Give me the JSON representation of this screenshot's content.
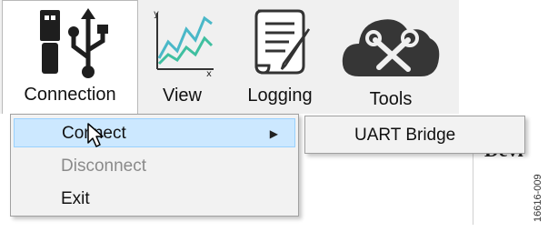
{
  "ribbon": {
    "buttons": [
      {
        "label": "Connection",
        "icon": "usb-icon",
        "active": true
      },
      {
        "label": "View",
        "icon": "line-chart-icon",
        "active": false
      },
      {
        "label": "Logging",
        "icon": "scroll-quill-icon",
        "active": false
      },
      {
        "label": "Tools",
        "icon": "cloud-tools-icon",
        "active": false
      }
    ]
  },
  "connection_menu": {
    "items": [
      {
        "label": "Connect",
        "state": "highlighted",
        "has_submenu": true,
        "arrow": "▶"
      },
      {
        "label": "Disconnect",
        "state": "disabled"
      },
      {
        "label": "Exit",
        "state": "enabled"
      }
    ]
  },
  "connect_submenu": {
    "items": [
      {
        "label": "UART Bridge"
      }
    ]
  },
  "background": {
    "heading_fragment": "Devi"
  },
  "figure_id": "16616-009",
  "colors": {
    "ribbon_bg": "#f0f0f0",
    "menu_bg": "#f2f2f2",
    "highlight_bg": "#cce8ff",
    "highlight_border": "#99d1ff",
    "disabled_text": "#8a8a8a",
    "chart_green": "#3fbfa0",
    "chart_teal": "#4ab8c8",
    "icon_dark": "#222222"
  }
}
